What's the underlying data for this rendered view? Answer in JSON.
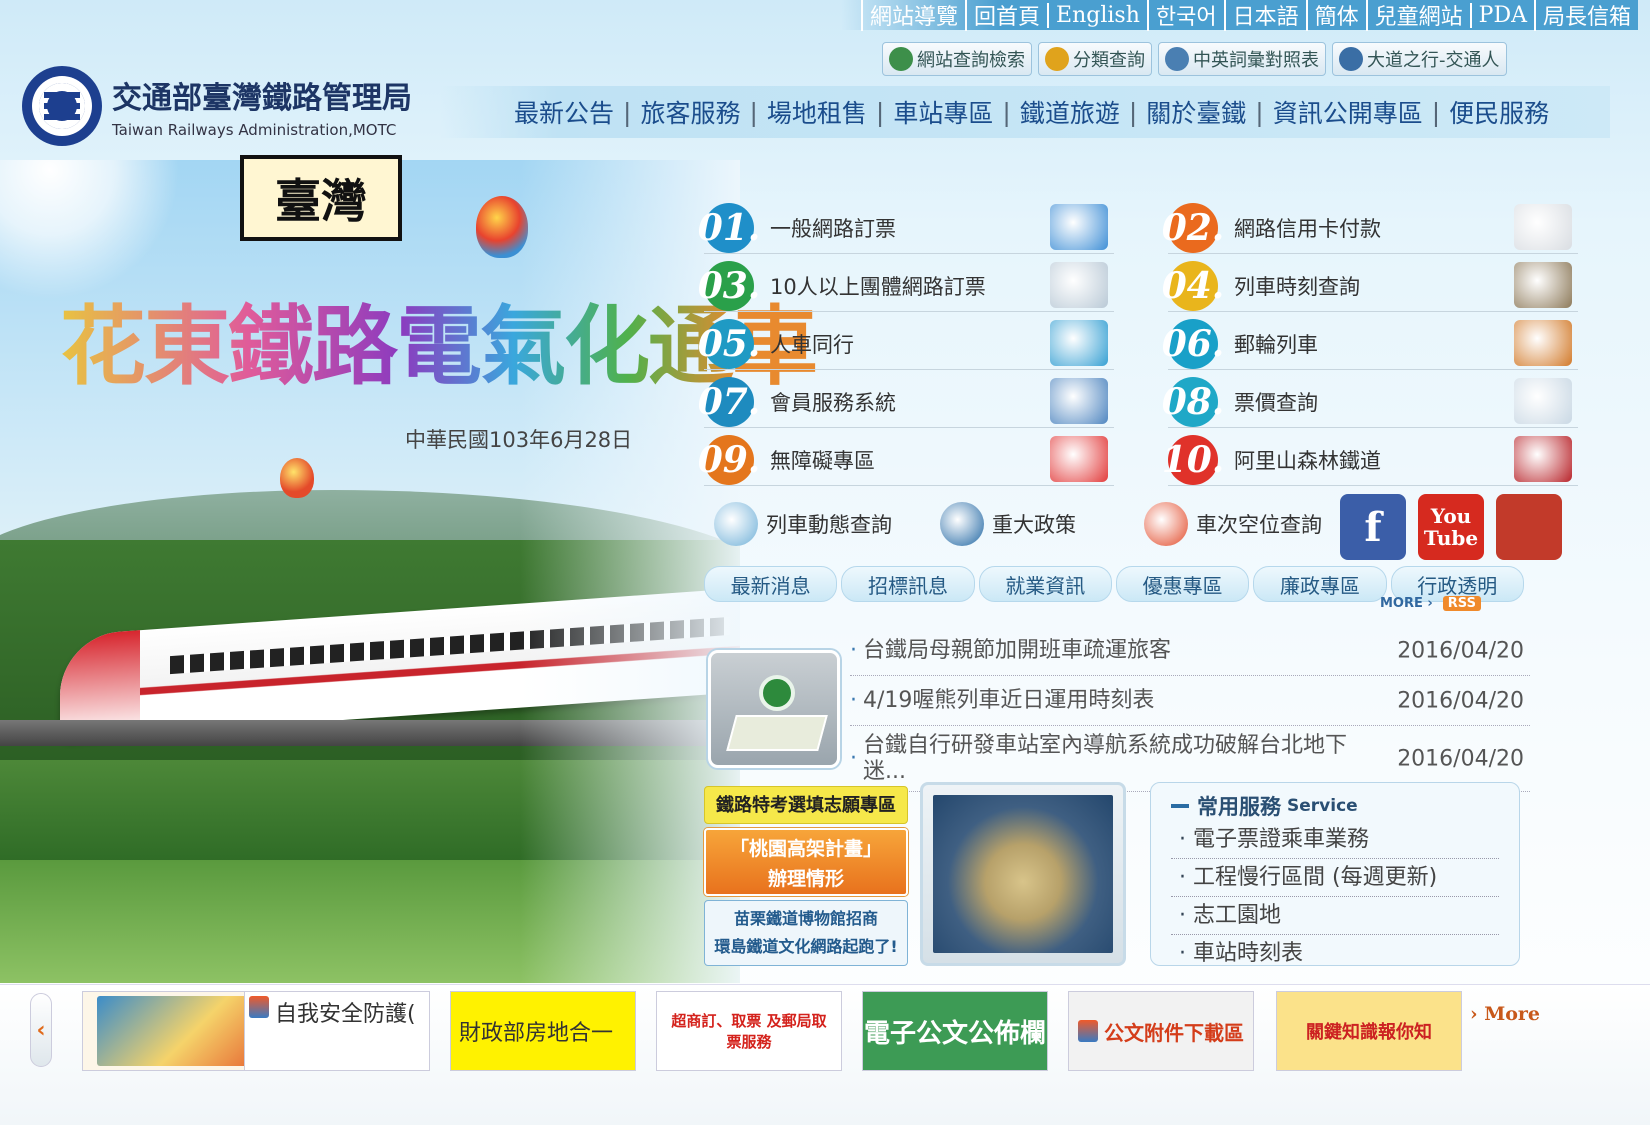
{
  "top_links": [
    "網站導覽",
    "回首頁",
    "English",
    "한국어",
    "日本語",
    "簡体",
    "兒童網站",
    "PDA",
    "局長信箱"
  ],
  "tools": [
    {
      "label": "網站查詢檢索",
      "icon": "globe-search-icon"
    },
    {
      "label": "分類查詢",
      "icon": "classify-icon"
    },
    {
      "label": "中英詞彙對照表",
      "icon": "glossary-icon"
    },
    {
      "label": "大道之行-交通人",
      "icon": "people-icon"
    }
  ],
  "logo": {
    "name_zh": "交通部臺灣鐵路管理局",
    "name_en": "Taiwan Railways Administration,MOTC"
  },
  "main_nav": [
    "最新公告",
    "旅客服務",
    "場地租售",
    "車站專區",
    "鐵道旅遊",
    "關於臺鐵",
    "資訊公開專區",
    "便民服務"
  ],
  "hero": {
    "tag": "臺灣",
    "slogan": "花東鐵路電氣化通車",
    "date": "中華民國103年6月28日"
  },
  "services": [
    {
      "num": "01.",
      "label": "一般網路訂票",
      "color": "#1f8fc9",
      "icon": "online-booking-icon"
    },
    {
      "num": "02.",
      "label": "網路信用卡付款",
      "color": "#ea6a1e",
      "icon": "credit-card-icon"
    },
    {
      "num": "03.",
      "label": "10人以上團體網路訂票",
      "color": "#2aa04a",
      "icon": "laptop-icon"
    },
    {
      "num": "04.",
      "label": "列車時刻查詢",
      "color": "#e9b51c",
      "icon": "timetable-icon"
    },
    {
      "num": "05.",
      "label": "人車同行",
      "color": "#1f9ac4",
      "icon": "bike-taiwan-icon"
    },
    {
      "num": "06.",
      "label": "郵輪列車",
      "color": "#19a0c8",
      "icon": "cruise-train-icon"
    },
    {
      "num": "07.",
      "label": "會員服務系統",
      "color": "#1e8bbf",
      "icon": "members-icon"
    },
    {
      "num": "08.",
      "label": "票價查詢",
      "color": "#1fa8c7",
      "icon": "magnifier-icon"
    },
    {
      "num": "09.",
      "label": "無障礙專區",
      "color": "#e4761d",
      "icon": "heart-laptop-icon"
    },
    {
      "num": "10.",
      "label": "阿里山森林鐵道",
      "color": "#e0322a",
      "icon": "alishan-train-icon"
    }
  ],
  "quick": [
    {
      "label": "列車動態查詢",
      "icon": "clock-icon"
    },
    {
      "label": "重大政策",
      "icon": "bus-icon"
    },
    {
      "label": "車次空位查詢",
      "icon": "calendar-icon"
    }
  ],
  "social": [
    {
      "name": "facebook",
      "glyph": "f",
      "color": "#3b5ea8"
    },
    {
      "name": "youtube",
      "glyph": "You Tube",
      "color": "#d62a1f"
    },
    {
      "name": "app",
      "glyph": "",
      "color": "#c23a2a"
    }
  ],
  "news_tabs": [
    "最新消息",
    "招標訊息",
    "就業資訊",
    "優惠專區",
    "廉政專區",
    "行政透明"
  ],
  "more_label": "MORE",
  "rss_label": "RSS",
  "news": [
    {
      "title": "台鐵局母親節加開班車疏運旅客",
      "date": "2016/04/20"
    },
    {
      "title": "4/19喔熊列車近日運用時刻表",
      "date": "2016/04/20"
    },
    {
      "title": "台鐵自行研發車站室內導航系統成功破解台北地下迷...",
      "date": "2016/04/20"
    }
  ],
  "promo": {
    "p1": "鐵路特考選填志願專區",
    "p2a": "「桃園高架計畫」",
    "p2b": "辦理情形",
    "p3a": "苗栗鐵道博物館招商",
    "p3b": "環島鐵道文化網路起跑了!"
  },
  "common": {
    "title": "常用服務",
    "title_en": "Service",
    "items": [
      "電子票證乘車業務",
      "工程慢行區間 (每週更新)",
      "志工園地",
      "車站時刻表"
    ]
  },
  "banners": [
    {
      "label": "",
      "bg": "#fdf6e8",
      "icon": "civil-service-banner"
    },
    {
      "label": "自我安全防護(",
      "bg": "#ffffff",
      "icon": "broken-image-icon"
    },
    {
      "label": "財政部房地合一",
      "bg": "#fff200",
      "icon": ""
    },
    {
      "label": "超商訂、取票 及郵局取票服務",
      "bg": "#ffffff",
      "icon": ""
    },
    {
      "label": "電子公文公佈欄",
      "bg": "#3d9b55",
      "icon": ""
    },
    {
      "label": "公文附件下載區",
      "bg": "#f2f2f2",
      "icon": "download-icon"
    },
    {
      "label": "關鍵知識報你知",
      "bg": "#fbe28a",
      "icon": ""
    }
  ],
  "prev_glyph": "‹",
  "more_banner": "› More"
}
